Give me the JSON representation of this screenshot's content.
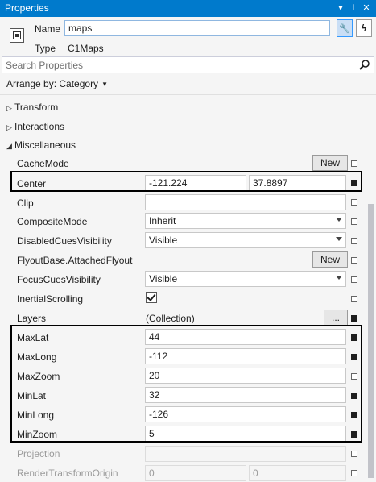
{
  "titlebar": {
    "title": "Properties",
    "dropdown_glyph": "▾",
    "pin_glyph": "⊥",
    "close_glyph": "✕"
  },
  "header": {
    "name_label": "Name",
    "name_value": "maps",
    "type_label": "Type",
    "type_value": "C1Maps",
    "properties_glyph": "🔧",
    "events_glyph": "ϟ"
  },
  "search": {
    "placeholder": "Search Properties"
  },
  "arrange": {
    "label": "Arrange by: Category",
    "caret": "▼"
  },
  "categories": {
    "transform": {
      "label": "Transform",
      "glyph": "▷"
    },
    "interactions": {
      "label": "Interactions",
      "glyph": "▷"
    },
    "misc": {
      "label": "Miscellaneous",
      "glyph": "◢"
    }
  },
  "props": {
    "cache_mode": {
      "label": "CacheMode",
      "button": "New"
    },
    "center": {
      "label": "Center",
      "x": "-121.224",
      "y": "37.8897"
    },
    "clip": {
      "label": "Clip",
      "value": ""
    },
    "composite_mode": {
      "label": "CompositeMode",
      "value": "Inherit"
    },
    "disabled_cues": {
      "label": "DisabledCuesVisibility",
      "value": "Visible"
    },
    "flyout": {
      "label": "FlyoutBase.AttachedFlyout",
      "button": "New"
    },
    "focus_cues": {
      "label": "FocusCuesVisibility",
      "value": "Visible"
    },
    "inertial": {
      "label": "InertialScrolling",
      "checked": true
    },
    "layers": {
      "label": "Layers",
      "value": "(Collection)",
      "button": "..."
    },
    "max_lat": {
      "label": "MaxLat",
      "value": "44"
    },
    "max_long": {
      "label": "MaxLong",
      "value": "-112"
    },
    "max_zoom": {
      "label": "MaxZoom",
      "value": "20"
    },
    "min_lat": {
      "label": "MinLat",
      "value": "32"
    },
    "min_long": {
      "label": "MinLong",
      "value": "-126"
    },
    "min_zoom": {
      "label": "MinZoom",
      "value": "5"
    },
    "projection": {
      "label": "Projection",
      "value": ""
    },
    "render_origin": {
      "label": "RenderTransformOrigin",
      "x": "0",
      "y": "0"
    }
  }
}
